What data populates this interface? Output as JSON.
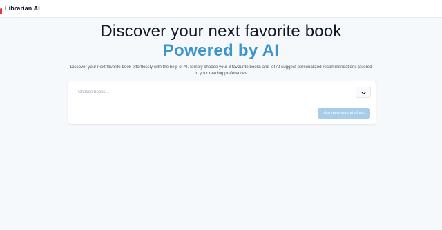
{
  "app": {
    "name": "Librarian AI"
  },
  "hero": {
    "title": "Discover your next favorite book",
    "subtitle": "Powered by AI",
    "description": "Discover your next favorite book effortlessly with the help of AI. Simply choose your 3 favourite books and let AI suggest personalized recommendations tailored to your reading preferences"
  },
  "form": {
    "select_placeholder": "Choose books...",
    "toggle_icon": "chevron-down-icon",
    "submit_label": "Get recommendations"
  },
  "colors": {
    "accent": "#3b93cf",
    "button_disabled": "#a7cdea",
    "background": "#f6f9fc",
    "brand_icon": "#e23b3b"
  }
}
